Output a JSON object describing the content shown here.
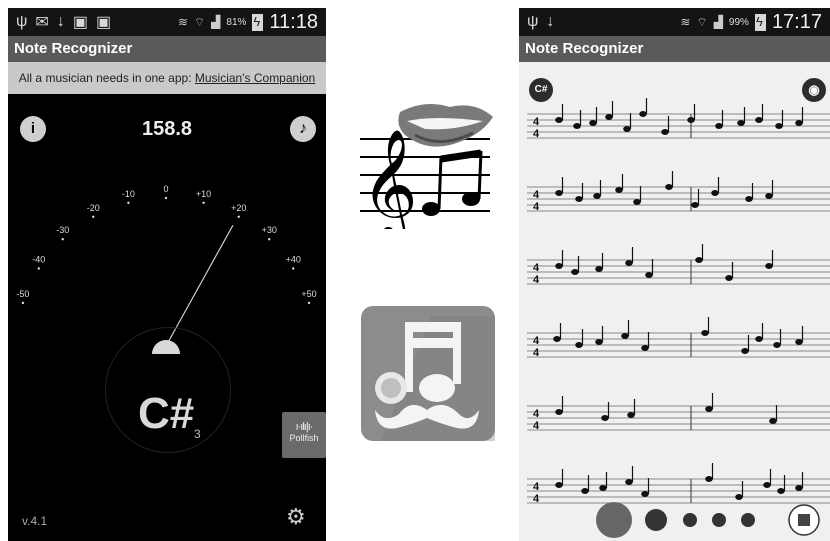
{
  "left_phone": {
    "status": {
      "time": "11:18",
      "battery": "81%"
    },
    "app_title": "Note Recognizer",
    "promo": {
      "prefix": "All a musician needs in one app: ",
      "link": "Musician's Companion"
    },
    "frequency": "158.8",
    "info_label": "i",
    "gauge_ticks": [
      "-50",
      "-40",
      "-30",
      "-20",
      "-10",
      "0",
      "+10",
      "+20",
      "+30",
      "+40",
      "+50"
    ],
    "needle_cents": 20,
    "note": "C#",
    "octave": "3",
    "pollfish_label": "Pollfish",
    "version": "v.4.1"
  },
  "right_phone": {
    "status": {
      "time": "17:17",
      "battery": "99%"
    },
    "app_title": "Note Recognizer",
    "key_button": "C#",
    "time_signature": {
      "top": "4",
      "bottom": "4"
    },
    "staff_count": 6
  },
  "icons": {
    "status_left": [
      "usb-icon",
      "no-sim-icon",
      "download-icon",
      "bag-icon",
      "bag-check-icon"
    ],
    "status_right": [
      "vibrate-icon",
      "wifi-icon",
      "signal-icon",
      "battery-icon"
    ],
    "info": "info-icon",
    "music": "music-note-icon",
    "settings": "gear-icon",
    "camera": "camera-icon",
    "record": "record-icon",
    "stop": "stop-icon"
  },
  "colors": {
    "status_bar": "#141414",
    "title_bar": "#5a5a5a",
    "promo": "#c9c9c9",
    "sheet": "#f0f0f0"
  }
}
